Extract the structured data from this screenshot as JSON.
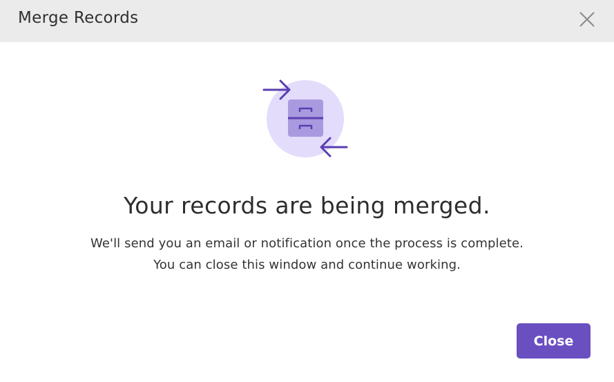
{
  "dialog": {
    "title": "Merge Records",
    "close_icon": "close-icon"
  },
  "illustration": {
    "icon": "merge-records-icon",
    "colors": {
      "circle": "#e4dcfb",
      "drawer": "#a99ae0",
      "stroke": "#5a3eb0"
    }
  },
  "message": {
    "headline": "Your records are being merged.",
    "line1": "We'll send you an email or notification once the process is complete.",
    "line2": "You can close this window and continue working."
  },
  "footer": {
    "close_label": "Close",
    "accent": "#6a4fc1"
  }
}
